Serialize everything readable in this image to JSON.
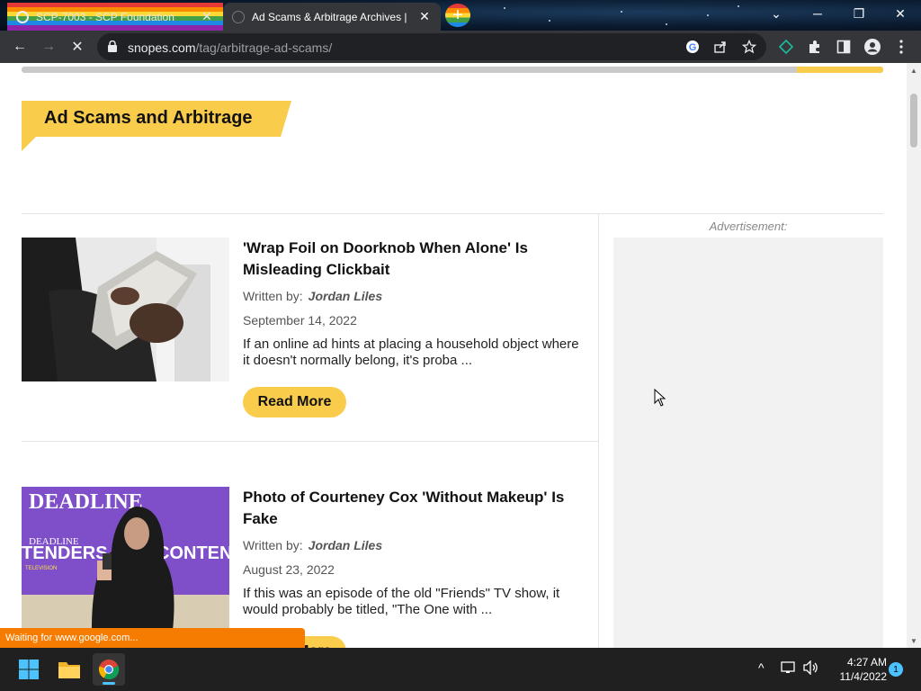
{
  "browser": {
    "tabs": [
      {
        "title": "SCP-7003 - SCP Foundation",
        "active": false
      },
      {
        "title": "Ad Scams & Arbitrage Archives |",
        "active": true
      }
    ],
    "new_tab_symbol": "+",
    "close_symbol": "✕",
    "window_controls": {
      "list": "⌄",
      "minimize": "─",
      "restore": "❐",
      "close": "✕"
    },
    "nav": {
      "back": "←",
      "forward": "→",
      "stop": "✕"
    },
    "url_host": "snopes.com",
    "url_path": "/tag/arbitrage-ad-scams/",
    "icons": [
      "google-lens-icon",
      "share-icon",
      "bookmark-star-icon",
      "extension-diamond-icon",
      "extensions-puzzle-icon",
      "side-panel-icon",
      "profile-icon",
      "menu-kebab-icon"
    ]
  },
  "page": {
    "tag_title": "Ad Scams and Arbitrage",
    "ad_label": "Advertisement:",
    "articles": [
      {
        "title": "'Wrap Foil on Doorknob When Alone' Is Misleading Clickbait",
        "written_by_label": "Written by:",
        "author": "Jordan Liles",
        "date": "September 14, 2022",
        "excerpt": "If an online ad hints at placing a household object where it doesn't normally belong, it's proba ...",
        "read_more": "Read More"
      },
      {
        "title": "Photo of Courteney Cox 'Without Makeup' Is Fake",
        "written_by_label": "Written by:",
        "author": "Jordan Liles",
        "date": "August 23, 2022",
        "excerpt": "If this was an episode of the old \"Friends\" TV show, it would probably be titled, \"The One with ...",
        "read_more": "Read More",
        "thumb_text_1": "DEADLINE",
        "thumb_text_2": "DEADLINE",
        "thumb_text_3": "TENDERS",
        "thumb_text_4": "CONTEND",
        "thumb_text_5": "TELEVISION"
      }
    ],
    "status_text": "Waiting for www.google.com..."
  },
  "taskbar": {
    "clock_time": "4:27 AM",
    "clock_date": "11/4/2022",
    "notification_count": "1",
    "tray_chevron": "^"
  },
  "colors": {
    "accent_yellow": "#f9cc4b",
    "chrome_dark": "#35363a",
    "status_orange": "#f57c00"
  }
}
